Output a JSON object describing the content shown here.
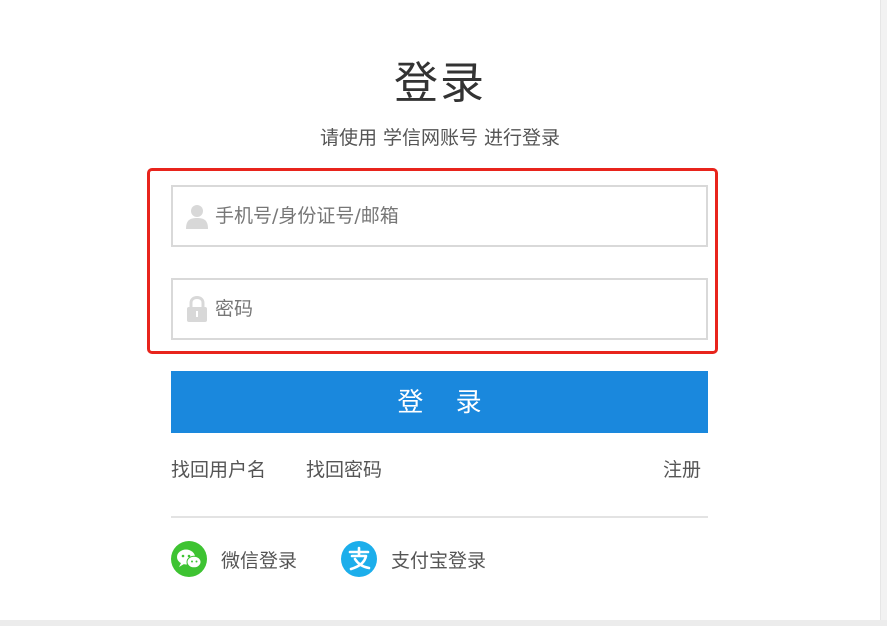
{
  "page": {
    "title": "登录",
    "subtitle": "请使用 学信网账号 进行登录"
  },
  "form": {
    "username_placeholder": "手机号/身份证号/邮箱",
    "password_placeholder": "密码",
    "submit_label": "登 录"
  },
  "links": {
    "find_username": "找回用户名",
    "find_password": "找回密码",
    "register": "注册"
  },
  "third_party": {
    "wechat_label": "微信登录",
    "alipay_label": "支付宝登录"
  },
  "icons": {
    "username": "user-icon",
    "password": "lock-icon",
    "wechat": "wechat-icon",
    "alipay": "alipay-icon"
  },
  "colors": {
    "primary_button": "#1a88dd",
    "highlight_border": "#e8241c",
    "wechat": "#3ec332",
    "alipay": "#1caeeb"
  }
}
